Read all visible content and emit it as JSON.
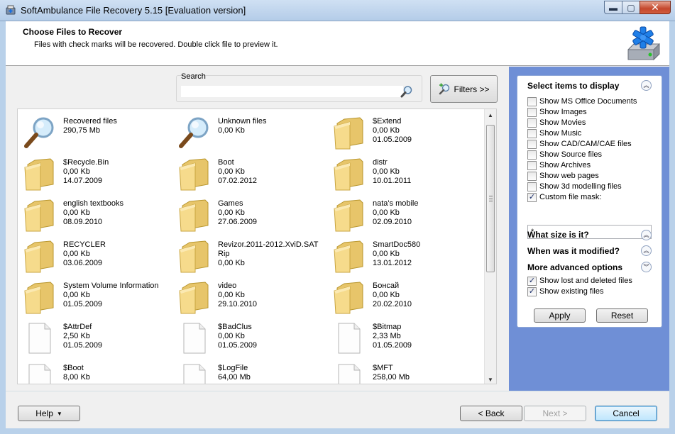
{
  "window": {
    "title": "SoftAmbulance File Recovery 5.15 [Evaluation version]",
    "min_glyph": "▬",
    "max_glyph": "▢",
    "close_glyph": "✕"
  },
  "header": {
    "title": "Choose Files to Recover",
    "subtitle": "Files with check marks will be recovered. Double click file to preview it."
  },
  "search": {
    "label": "Search",
    "value": ""
  },
  "filters_button": "Filters >>",
  "files": [
    {
      "name": "Recovered files",
      "size": "290,75 Mb",
      "date": "",
      "icon": "magnifier-icon"
    },
    {
      "name": "Unknown files",
      "size": "0,00 Kb",
      "date": "",
      "icon": "magnifier-icon"
    },
    {
      "name": "$Extend",
      "size": "0,00 Kb",
      "date": "01.05.2009",
      "icon": "folder-icon"
    },
    {
      "name": "$Recycle.Bin",
      "size": "0,00 Kb",
      "date": "14.07.2009",
      "icon": "folder-icon"
    },
    {
      "name": "Boot",
      "size": "0,00 Kb",
      "date": "07.02.2012",
      "icon": "folder-icon"
    },
    {
      "name": "distr",
      "size": "0,00 Kb",
      "date": "10.01.2011",
      "icon": "folder-icon"
    },
    {
      "name": "english textbooks",
      "size": "0,00 Kb",
      "date": "08.09.2010",
      "icon": "folder-icon"
    },
    {
      "name": "Games",
      "size": "0,00 Kb",
      "date": "27.06.2009",
      "icon": "folder-icon"
    },
    {
      "name": "nata's mobile",
      "size": "0,00 Kb",
      "date": "02.09.2010",
      "icon": "folder-icon"
    },
    {
      "name": "RECYCLER",
      "size": "0,00 Kb",
      "date": "03.06.2009",
      "icon": "folder-icon"
    },
    {
      "name": "Revizor.2011-2012.XviD.SATRip",
      "size": "0,00 Kb",
      "date": "",
      "icon": "folder-icon"
    },
    {
      "name": "SmartDoc580",
      "size": "0,00 Kb",
      "date": "13.01.2012",
      "icon": "folder-icon"
    },
    {
      "name": "System Volume Information",
      "size": "0,00 Kb",
      "date": "01.05.2009",
      "icon": "folder-icon"
    },
    {
      "name": "video",
      "size": "0,00 Kb",
      "date": "29.10.2010",
      "icon": "folder-icon"
    },
    {
      "name": "Бонсай",
      "size": "0,00 Kb",
      "date": "20.02.2010",
      "icon": "folder-icon"
    },
    {
      "name": "$AttrDef",
      "size": "2,50 Kb",
      "date": "01.05.2009",
      "icon": "file-icon"
    },
    {
      "name": "$BadClus",
      "size": "0,00 Kb",
      "date": "01.05.2009",
      "icon": "file-icon"
    },
    {
      "name": "$Bitmap",
      "size": "2,33 Mb",
      "date": "01.05.2009",
      "icon": "file-icon"
    },
    {
      "name": "$Boot",
      "size": "8,00 Kb",
      "date": "",
      "icon": "file-icon"
    },
    {
      "name": "$LogFile",
      "size": "64,00 Mb",
      "date": "",
      "icon": "file-icon"
    },
    {
      "name": "$MFT",
      "size": "258,00 Mb",
      "date": "",
      "icon": "file-icon"
    }
  ],
  "options": {
    "select_heading": "Select items to display",
    "checkboxes": [
      {
        "label": "Show MS Office Documents",
        "checked": false
      },
      {
        "label": "Show Images",
        "checked": false
      },
      {
        "label": "Show Movies",
        "checked": false
      },
      {
        "label": "Show Music",
        "checked": false
      },
      {
        "label": "Show CAD/CAM/CAE files",
        "checked": false
      },
      {
        "label": "Show Source files",
        "checked": false
      },
      {
        "label": "Show Archives",
        "checked": false
      },
      {
        "label": "Show web pages",
        "checked": false
      },
      {
        "label": "Show 3d modelling files",
        "checked": false
      },
      {
        "label": "Custom file mask:",
        "checked": true
      }
    ],
    "mask_value": "*",
    "size_heading": "What size is it?",
    "modified_heading": "When was it modified?",
    "advanced_heading": "More advanced options",
    "advanced_checkboxes": [
      {
        "label": "Show lost and deleted files",
        "checked": true
      },
      {
        "label": "Show existing files",
        "checked": true
      }
    ],
    "apply": "Apply",
    "reset": "Reset"
  },
  "footer": {
    "help": "Help",
    "back": "< Back",
    "next": "Next >",
    "cancel": "Cancel"
  }
}
